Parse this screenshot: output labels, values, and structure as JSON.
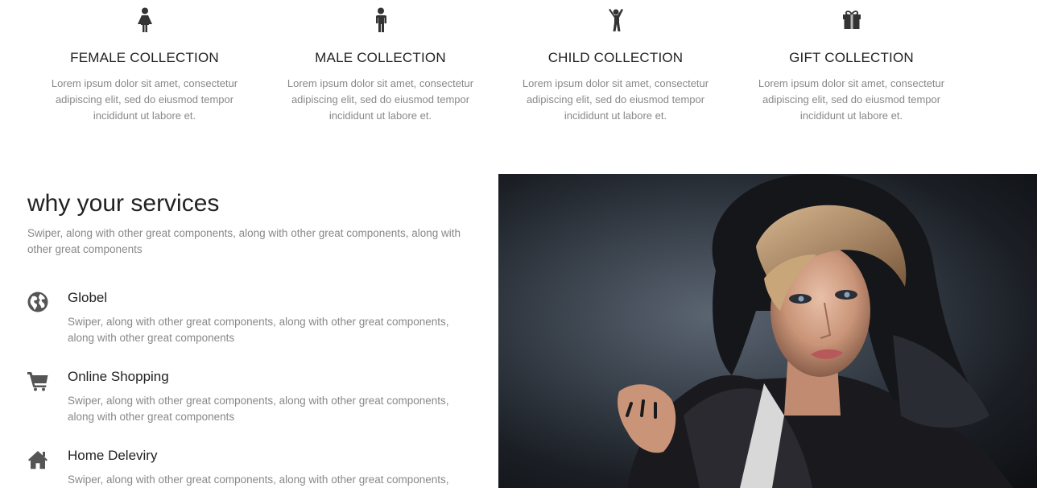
{
  "collections": [
    {
      "title": "FEMALE COLLECTION",
      "desc": "Lorem ipsum dolor sit amet, consectetur adipiscing elit, sed do eiusmod tempor incididunt ut labore et.",
      "icon": "female-icon"
    },
    {
      "title": "MALE COLLECTION",
      "desc": "Lorem ipsum dolor sit amet, consectetur adipiscing elit, sed do eiusmod tempor incididunt ut labore et.",
      "icon": "male-icon"
    },
    {
      "title": "CHILD COLLECTION",
      "desc": "Lorem ipsum dolor sit amet, consectetur adipiscing elit, sed do eiusmod tempor incididunt ut labore et.",
      "icon": "child-icon"
    },
    {
      "title": "GIFT COLLECTION",
      "desc": "Lorem ipsum dolor sit amet, consectetur adipiscing elit, sed do eiusmod tempor incididunt ut labore et.",
      "icon": "gift-icon"
    }
  ],
  "services": {
    "heading": "why your services",
    "intro": "Swiper, along with other great components, along with other great components, along with other great components",
    "items": [
      {
        "title": "Globel",
        "desc": "Swiper, along with other great components, along with other great components, along with other great components",
        "icon": "globe-icon"
      },
      {
        "title": "Online Shopping",
        "desc": "Swiper, along with other great components, along with other great components, along with other great components",
        "icon": "cart-icon"
      },
      {
        "title": "Home Deleviry",
        "desc": "Swiper, along with other great components, along with other great components, along with other great components",
        "icon": "home-icon"
      }
    ]
  },
  "colors": {
    "heading": "#222222",
    "body_text": "#888888",
    "icon": "#333333",
    "service_icon": "#555555"
  }
}
